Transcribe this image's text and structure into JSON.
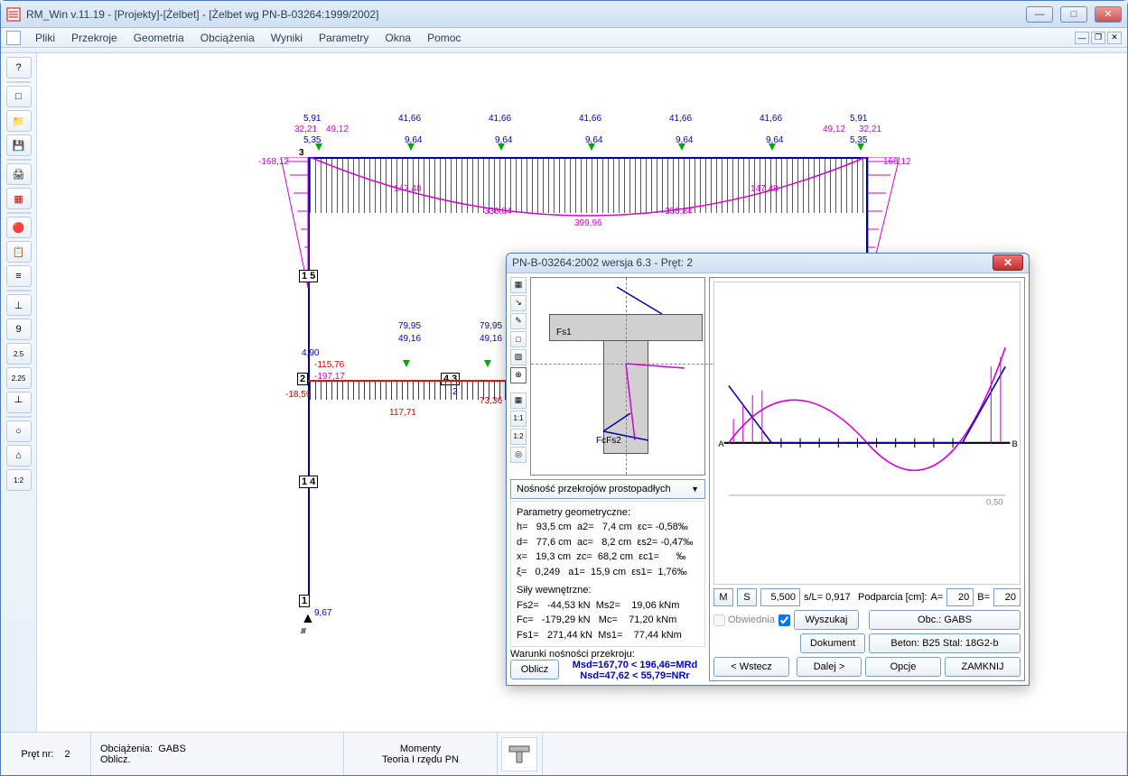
{
  "window": {
    "title": "RM_Win v.11.19 - [Projekty]-[Żelbet] - [Żelbet wg PN-B-03264:1999/2002]"
  },
  "menu": {
    "items": [
      "Pliki",
      "Przekroje",
      "Geometria",
      "Obciążenia",
      "Wyniki",
      "Parametry",
      "Okna",
      "Pomoc"
    ]
  },
  "left_toolbar": {
    "buttons": [
      "?",
      "□",
      "📁",
      "💾",
      "🖨",
      "▦",
      "🔴",
      "📋",
      "≡",
      "⊥",
      "9",
      "2.5",
      "2.25",
      "┴",
      "○",
      "⌂",
      "1:2"
    ]
  },
  "diagram": {
    "top_vals": [
      "5,91",
      "41,66",
      "41,66",
      "41,66",
      "41,66",
      "41,66",
      "5,91"
    ],
    "top_vals2": [
      "32,21",
      "49,12",
      "",
      "",
      "",
      "",
      "49,12",
      "32,21"
    ],
    "top_vals3": [
      "5,35",
      "9,64",
      "9,64",
      "9,64",
      "9,64",
      "9,64",
      "5,35"
    ],
    "left_moment": "-168,12",
    "right_moment": "168,12",
    "mid_moments": [
      "147,48",
      "336,84",
      "399,96",
      "336,84",
      "147,48"
    ],
    "lower_vals": [
      "79,95",
      "79,95"
    ],
    "lower_vals2": [
      "49,16",
      "49,16"
    ],
    "left_lower": "4,90",
    "left_lower_moment": "-115,76",
    "left_lower_moment2": "-197,17",
    "left_lower_moment3": "-18,59",
    "mid_lower_moments": [
      "117,71",
      "73,36"
    ],
    "node_labels": [
      "1",
      "2",
      "3",
      "4",
      "5"
    ],
    "mid_node": "4 3",
    "support_val": "9,67"
  },
  "status": {
    "pret_nr_label": "Pręt nr:",
    "pret_nr": "2",
    "obc_label": "Obciążenia:",
    "obc_val": "GABS",
    "oblicz": "Oblicz.",
    "momenty": "Momenty",
    "teoria": "Teoria I rzędu PN"
  },
  "dialog": {
    "title": "PN-B-03264:2002 wersja 6.3 - Pręt: 2",
    "mini_tools": [
      "▦",
      "↘",
      "✎",
      "□",
      "▨",
      "⊗",
      "▦",
      "1:1",
      "1:2",
      "◎"
    ],
    "cs_label_fs1": "Fs1",
    "cs_label_fc": "FcFs2",
    "combo": "Nośność przekrojów prostopadłych",
    "params_hdr": "Parametry geometryczne:",
    "params": {
      "h": "93,5 cm",
      "a2": "7,4 cm",
      "ec": "-0,58‰",
      "d": "77,6 cm",
      "ac": "8,2 cm",
      "es2": "-0,47‰",
      "x": "19,3 cm",
      "zc": "68,2 cm",
      "ec1": "‰",
      "xi": "0,249",
      "a1": "15,9 cm",
      "es1": "1,76‰"
    },
    "forces_hdr": "Siły wewnętrzne:",
    "forces": {
      "Fs2": "-44,53 kN",
      "Ms2": "19,06 kNm",
      "Fc": "-179,29 kN",
      "Mc": "71,20 kNm",
      "Fs1": "271,44 kN",
      "Ms1": "77,44 kNm"
    },
    "cond_hdr": "Warunki nośności przekroju:",
    "cond1": "Msd=167,70 < 196,46=MRd",
    "cond2": "Nsd=47,62 < 55,79=NRr",
    "oblicz_btn": "Oblicz",
    "right_fields": {
      "M": "M",
      "S": "S",
      "s_val": "5,500",
      "sL": "s/L= 0,917",
      "podparcia": "Podparcia [cm]:",
      "A": "A=",
      "A_val": "20",
      "B": "B=",
      "B_val": "20",
      "env_dim": "0,50"
    },
    "bottom": {
      "obwiednia": "Obwiednia",
      "wyszukaj": "Wyszukaj",
      "obc_btn": "Obc.: GABS",
      "dokument": "Dokument",
      "beton_stal": "Beton: B25   Stal: 18G2-b",
      "wstecz": "< Wstecz",
      "dalej": "Dalej >",
      "opcje": "Opcje",
      "zamknij": "ZAMKNIJ"
    }
  }
}
